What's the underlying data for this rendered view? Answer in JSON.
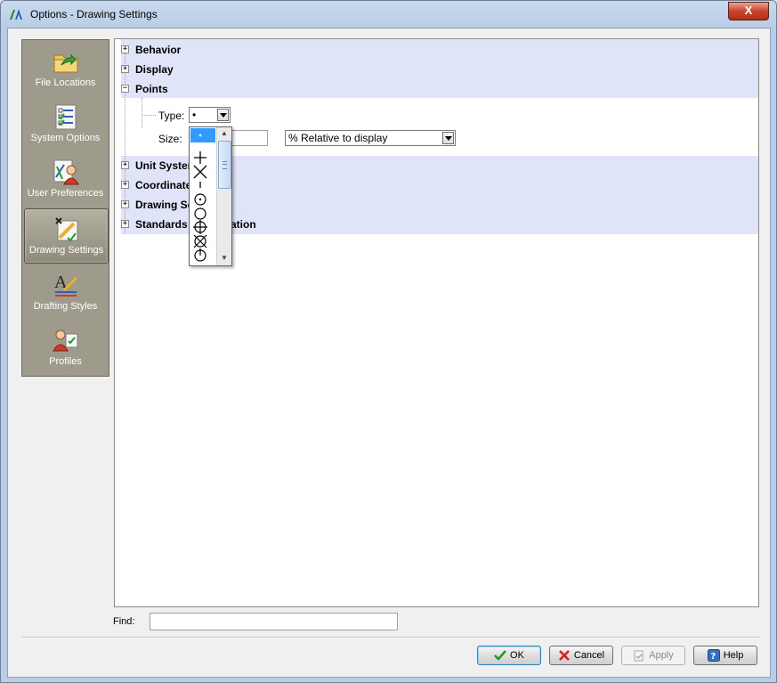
{
  "window": {
    "title": "Options - Drawing Settings",
    "close_glyph": "X"
  },
  "nav": {
    "items": [
      {
        "label": "File Locations",
        "icon": "folder-arrow-icon"
      },
      {
        "label": "System Options",
        "icon": "checklist-icon"
      },
      {
        "label": "User Preferences",
        "icon": "user-preferences-icon"
      },
      {
        "label": "Drawing Settings",
        "icon": "drawing-settings-icon",
        "selected": true
      },
      {
        "label": "Drafting Styles",
        "icon": "drafting-styles-icon"
      },
      {
        "label": "Profiles",
        "icon": "profiles-icon"
      }
    ]
  },
  "tree": {
    "nodes": [
      {
        "label": "Behavior",
        "expander": "+"
      },
      {
        "label": "Display",
        "expander": "+"
      },
      {
        "label": "Points",
        "expander": "−"
      },
      {
        "label": "Unit Systen",
        "expander": "+"
      },
      {
        "label": "Coordinate",
        "expander": "+"
      },
      {
        "label": "Drawing Se",
        "expander": "+"
      },
      {
        "label": "Standards C",
        "expander": "+",
        "suffix": "ation"
      }
    ],
    "points": {
      "type_label": "Type:",
      "type_value": "•",
      "size_label": "Size:",
      "size_value": "",
      "size_mode": "% Relative to display"
    },
    "type_dropdown": {
      "options": [
        "dot",
        "none",
        "plus",
        "x-cross",
        "tick",
        "circle-dot",
        "circle",
        "circle-plus",
        "circle-x",
        "circle-tick"
      ],
      "selected_index": 0
    }
  },
  "find": {
    "label": "Find:",
    "value": ""
  },
  "buttons": {
    "ok": "OK",
    "cancel": "Cancel",
    "apply": "Apply",
    "help": "Help"
  },
  "colors": {
    "selection": "#3399ff",
    "band": "#e0e4f8",
    "nav_bg": "#9f9b8c"
  }
}
